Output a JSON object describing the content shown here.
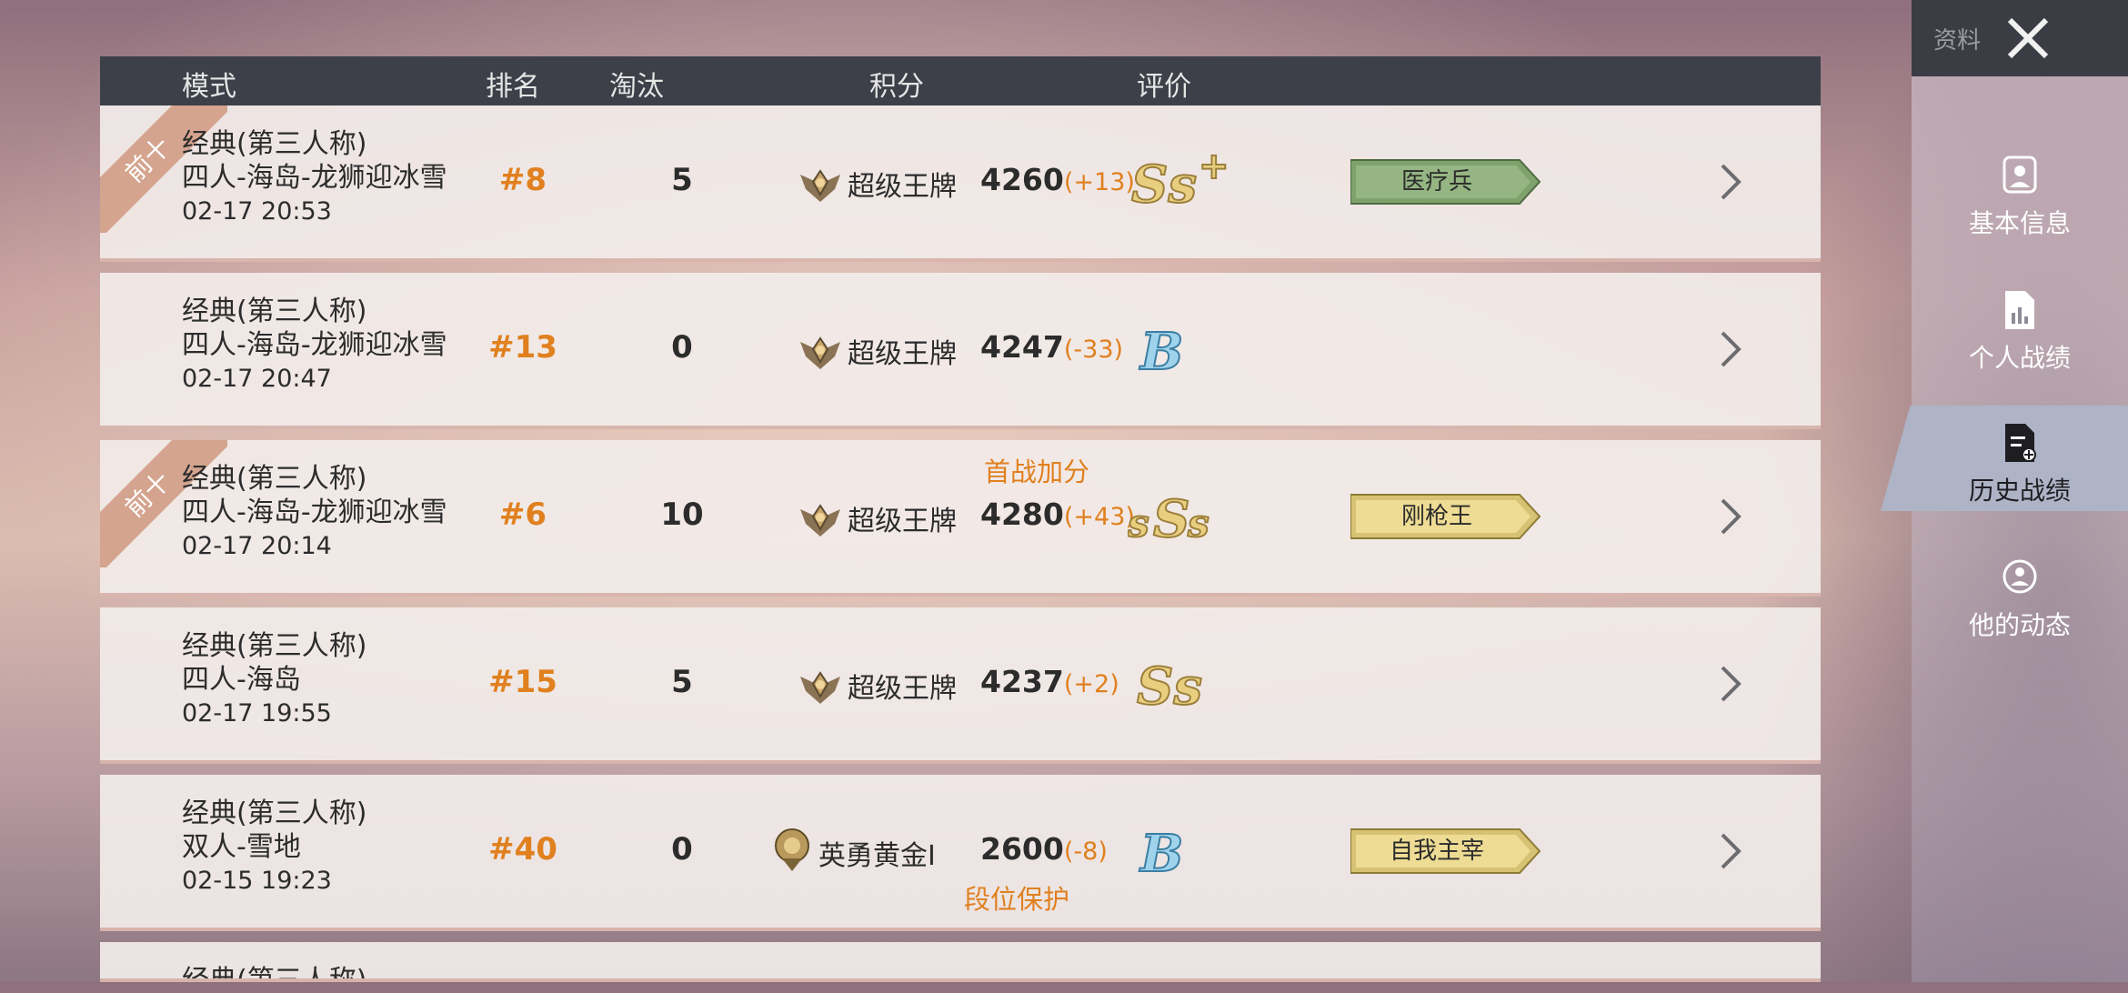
{
  "header": {
    "col_mode": "模式",
    "col_rank": "排名",
    "col_kills": "淘汰",
    "col_score": "积分",
    "col_grade": "评价"
  },
  "colors": {
    "accent_orange": "#e0801f",
    "header_bg": "#3d4048",
    "badge_green": "#7fa26c",
    "badge_gold": "#e7d58a"
  },
  "matches": [
    {
      "ribbon": "前十",
      "mode_line1": "经典(第三人称)",
      "mode_line2": "四人-海岛-龙狮迎冰雪",
      "date": "02-17 20:53",
      "rank": "#8",
      "kills": "5",
      "tier_icon": "ace-tier-icon",
      "tier": "超级王牌",
      "score": "4260",
      "delta": "(+13)",
      "grade": "SS+",
      "badge": "医疗兵",
      "note_above": "",
      "note_below": ""
    },
    {
      "ribbon": "",
      "mode_line1": "经典(第三人称)",
      "mode_line2": "四人-海岛-龙狮迎冰雪",
      "date": "02-17 20:47",
      "rank": "#13",
      "kills": "0",
      "tier_icon": "ace-tier-icon",
      "tier": "超级王牌",
      "score": "4247",
      "delta": "(-33)",
      "grade": "B",
      "badge": "",
      "note_above": "",
      "note_below": ""
    },
    {
      "ribbon": "前十",
      "mode_line1": "经典(第三人称)",
      "mode_line2": "四人-海岛-龙狮迎冰雪",
      "date": "02-17 20:14",
      "rank": "#6",
      "kills": "10",
      "tier_icon": "ace-tier-icon",
      "tier": "超级王牌",
      "score": "4280",
      "delta": "(+43)",
      "grade": "SSS",
      "badge": "刚枪王",
      "note_above": "首战加分",
      "note_below": ""
    },
    {
      "ribbon": "",
      "mode_line1": "经典(第三人称)",
      "mode_line2": "四人-海岛",
      "date": "02-17 19:55",
      "rank": "#15",
      "kills": "5",
      "tier_icon": "ace-tier-icon",
      "tier": "超级王牌",
      "score": "4237",
      "delta": "(+2)",
      "grade": "SS",
      "badge": "",
      "note_above": "",
      "note_below": ""
    },
    {
      "ribbon": "",
      "mode_line1": "经典(第三人称)",
      "mode_line2": "双人-雪地",
      "date": "02-15 19:23",
      "rank": "#40",
      "kills": "0",
      "tier_icon": "gold-tier-icon",
      "tier": "英勇黄金Ⅰ",
      "score": "2600",
      "delta": "(-8)",
      "grade": "B",
      "badge": "自我主宰",
      "note_above": "",
      "note_below": "段位保护"
    }
  ],
  "partial_row": {
    "mode_line1": "经典(第三人称)"
  },
  "sidebar": {
    "top_label": "资料",
    "items": [
      {
        "label": "基本信息",
        "icon": "profile-icon"
      },
      {
        "label": "个人战绩",
        "icon": "stats-document-icon"
      },
      {
        "label": "历史战绩",
        "icon": "history-document-icon",
        "active": true
      },
      {
        "label": "他的动态",
        "icon": "activity-icon"
      }
    ]
  }
}
